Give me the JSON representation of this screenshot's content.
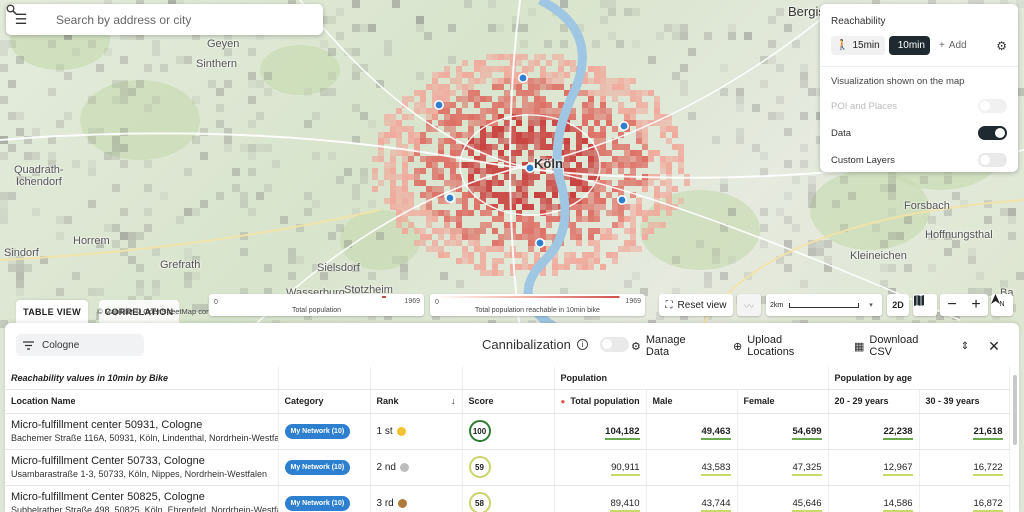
{
  "search": {
    "placeholder": "Search by address or city"
  },
  "map": {
    "places": [
      {
        "id": "bergisch",
        "text": "Bergis"
      },
      {
        "id": "geyen",
        "text": "Geyen"
      },
      {
        "id": "sinthern",
        "text": "Sinthern"
      },
      {
        "id": "quadrath",
        "text": "Quadrath-"
      },
      {
        "id": "ichendorf",
        "text": "Ichendorf"
      },
      {
        "id": "horrem",
        "text": "Horrem"
      },
      {
        "id": "sindorf",
        "text": "Sindorf"
      },
      {
        "id": "grefrath",
        "text": "Grefrath"
      },
      {
        "id": "sielsdorf",
        "text": "Sielsdorf"
      },
      {
        "id": "wasserburg",
        "text": "Wasserburg"
      },
      {
        "id": "stotzheim",
        "text": "Stotzheim"
      },
      {
        "id": "koln",
        "text": "Köln"
      },
      {
        "id": "forsbach",
        "text": "Forsbach"
      },
      {
        "id": "hoffnungsthal",
        "text": "Hoffnungsthal"
      },
      {
        "id": "kleineichen",
        "text": "Kleineichen"
      },
      {
        "id": "ba",
        "text": "Ba"
      }
    ],
    "attribution": "© MapTiler © OpenStreetMap contributors",
    "tabs": {
      "table_view": "TABLE VIEW",
      "correlation": "CORRELATION"
    },
    "legend_population": {
      "min": "0",
      "max": "1969",
      "caption": "Total population"
    },
    "legend_reachable": {
      "min": "0",
      "max": "1969",
      "caption": "Total population reachable in 10min bike"
    },
    "reset_label": "Reset view",
    "scale_label": "2km",
    "mode_2d": "2D",
    "zoom_out": "−",
    "zoom_in": "+",
    "north_label": "N"
  },
  "reachability": {
    "title": "Reachability",
    "walk_label": "15min",
    "bike_label": "10min",
    "add_label": "Add",
    "vis_title": "Visualization shown on the map",
    "layers": [
      {
        "label": "POI and Places",
        "enabled": false,
        "disabled": true
      },
      {
        "label": "Data",
        "enabled": true,
        "disabled": false
      },
      {
        "label": "Custom Layers",
        "enabled": false,
        "disabled": false
      }
    ]
  },
  "panel": {
    "filter_value": "Cologne",
    "cannibalization_label": "Cannibalization",
    "manage_data": "Manage Data",
    "upload_locations": "Upload Locations",
    "download_csv": "Download CSV",
    "caption": "Reachability values in 10min by Bike",
    "group_population": "Population",
    "group_age": "Population by age",
    "columns": {
      "location": "Location Name",
      "category": "Category",
      "rank": "Rank",
      "score": "Score",
      "total_population": "Total population",
      "male": "Male",
      "female": "Female",
      "age_20_29": "20 - 29 years",
      "age_30_39": "30 - 39 years"
    },
    "rows": [
      {
        "name": "Micro-fulfillment center 50931, Cologne",
        "address": "Bachemer Straße 116A, 50931, Köln, Lindenthal, Nordrhein-Westfal...",
        "category": "My Network (10)",
        "rank": "1 st",
        "medal_color": "#f2c230",
        "score": "100",
        "score_color": "#2e7d32",
        "total_population": "104,182",
        "male": "49,463",
        "female": "54,699",
        "age_20_29": "22,238",
        "age_30_39": "21,618",
        "bold": true
      },
      {
        "name": "Micro-fulfillment Center 50733, Cologne",
        "address": "Usambarastraße 1-3, 50733, Köln, Nippes, Nordrhein-Westfalen",
        "category": "My Network (10)",
        "rank": "2 nd",
        "medal_color": "#bdbdbd",
        "score": "59",
        "score_color": "#c9d46a",
        "total_population": "90,911",
        "male": "43,583",
        "female": "47,325",
        "age_20_29": "12,967",
        "age_30_39": "16,722",
        "bold": false
      },
      {
        "name": "Micro-fulfillment Center 50825, Cologne",
        "address": "Subbelrather Straße 498, 50825, Köln, Ehrenfeld, Nordrhein-Westfal...",
        "category": "My Network (10)",
        "rank": "3 rd",
        "medal_color": "#b07a3a",
        "score": "58",
        "score_color": "#c9d46a",
        "total_population": "89,410",
        "male": "43,744",
        "female": "45,646",
        "age_20_29": "14,586",
        "age_30_39": "16,872",
        "bold": false
      }
    ]
  }
}
